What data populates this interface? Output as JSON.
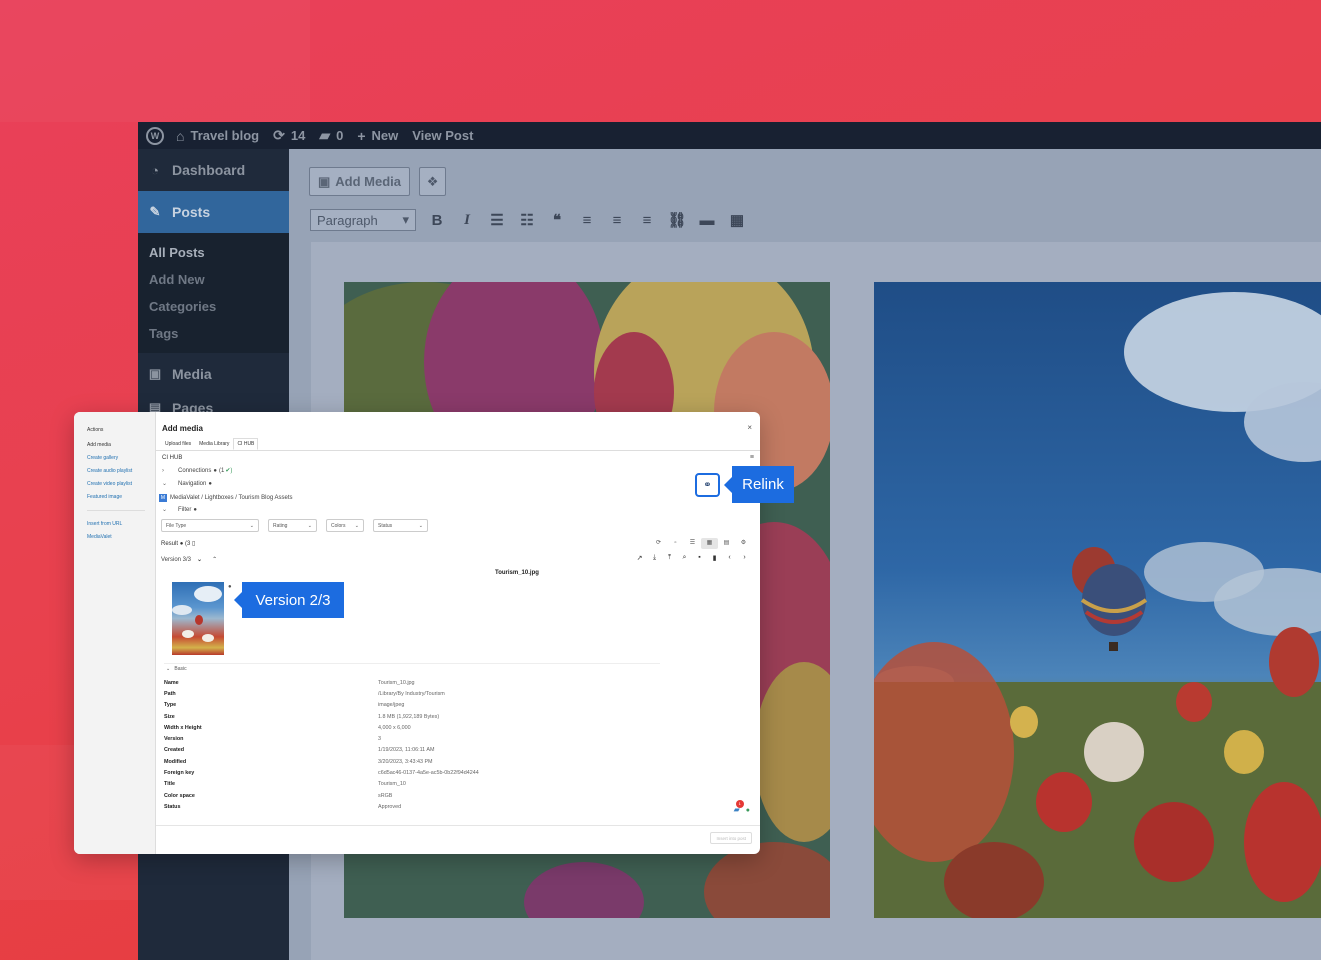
{
  "adminbar": {
    "site_name": "Travel blog",
    "updates_count": "14",
    "comments_count": "0",
    "new_label": "New",
    "view_post_label": "View Post"
  },
  "sidebar": {
    "dashboard": "Dashboard",
    "posts": "Posts",
    "submenu": [
      "All Posts",
      "Add New",
      "Categories",
      "Tags"
    ],
    "media": "Media",
    "pages": "Pages"
  },
  "editor": {
    "add_media_label": "Add Media",
    "format_select": "Paragraph"
  },
  "modal": {
    "sidebar_title": "Actions",
    "sidebar_links": [
      "Add media",
      "Create gallery",
      "Create audio playlist",
      "Create video playlist",
      "Featured image"
    ],
    "sidebar_links_2": [
      "Insert from URL",
      "MediaValet"
    ],
    "title": "Add media",
    "close": "×",
    "tabs": [
      "Upload files",
      "Media Library",
      "CI HUB"
    ],
    "cihub_label": "CI HUB",
    "connections_label": "Connections",
    "connections_count": "(1",
    "navigation_label": "Navigation",
    "breadcrumb": "MediaValet / Lightboxes / Tourism Blog Assets",
    "filter_label": "Filter",
    "filters": [
      "File Type",
      "Rating",
      "Colors",
      "Status"
    ],
    "result_label": "Result",
    "result_count": "(3",
    "version_label": "Version 3/3",
    "file_title": "Tourism_10.jpg",
    "basic_label": "Basic",
    "properties": [
      {
        "key": "Name",
        "value": "Tourism_10.jpg"
      },
      {
        "key": "Path",
        "value": "/Library/By Industry/Tourism"
      },
      {
        "key": "Type",
        "value": "image/jpeg"
      },
      {
        "key": "Size",
        "value": "1.8 MB (1,922,189 Bytes)"
      },
      {
        "key": "Width x Height",
        "value": "4,000 x 6,000"
      },
      {
        "key": "Version",
        "value": "3"
      },
      {
        "key": "Created",
        "value": "1/19/2023, 11:06:11 AM"
      },
      {
        "key": "Modified",
        "value": "3/20/2023, 3:43:43 PM"
      },
      {
        "key": "Foreign key",
        "value": "c6d5ac46-0137-4a5e-ac5b-0b22f94d4244"
      },
      {
        "key": "Title",
        "value": "Tourism_10"
      },
      {
        "key": "Color space",
        "value": "sRGB"
      },
      {
        "key": "Status",
        "value": "Approved"
      }
    ],
    "notification_badge": "1",
    "insert_button": "Insert into post"
  },
  "callouts": {
    "relink": "Relink",
    "version": "Version 2/3"
  }
}
